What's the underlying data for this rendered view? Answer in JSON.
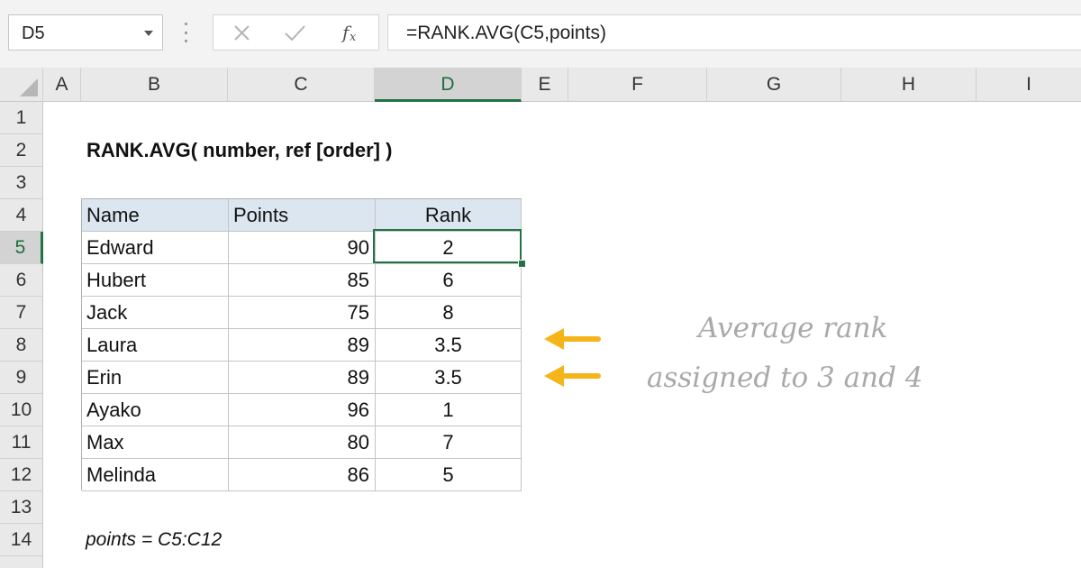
{
  "formula_bar": {
    "name_box": "D5",
    "cancel_icon": "close-icon",
    "enter_icon": "check-icon",
    "function_icon": "fx-icon",
    "formula": "=RANK.AVG(C5,points)"
  },
  "columns": [
    "A",
    "B",
    "C",
    "D",
    "E",
    "F",
    "G",
    "H",
    "I"
  ],
  "active_column": "D",
  "rows": [
    "1",
    "2",
    "3",
    "4",
    "5",
    "6",
    "7",
    "8",
    "9",
    "10",
    "11",
    "12",
    "13",
    "14"
  ],
  "active_row": "5",
  "heading": "RANK.AVG( number, ref [order] )",
  "table": {
    "headers": [
      "Name",
      "Points",
      "Rank"
    ],
    "rows": [
      {
        "name": "Edward",
        "points": "90",
        "rank": "2"
      },
      {
        "name": "Hubert",
        "points": "85",
        "rank": "6"
      },
      {
        "name": "Jack",
        "points": "75",
        "rank": "8"
      },
      {
        "name": "Laura",
        "points": "89",
        "rank": "3.5"
      },
      {
        "name": "Erin",
        "points": "89",
        "rank": "3.5"
      },
      {
        "name": "Ayako",
        "points": "96",
        "rank": "1"
      },
      {
        "name": "Max",
        "points": "80",
        "rank": "7"
      },
      {
        "name": "Melinda",
        "points": "86",
        "rank": "5"
      }
    ]
  },
  "named_range_note": "points = C5:C12",
  "annotation": {
    "line1": "Average rank",
    "line2": "assigned to 3 and 4",
    "arrow_color": "#f5b51a",
    "text_color": "#a9a9a9"
  },
  "colors": {
    "selection": "#217346",
    "table_header_fill": "#dce6f1"
  }
}
